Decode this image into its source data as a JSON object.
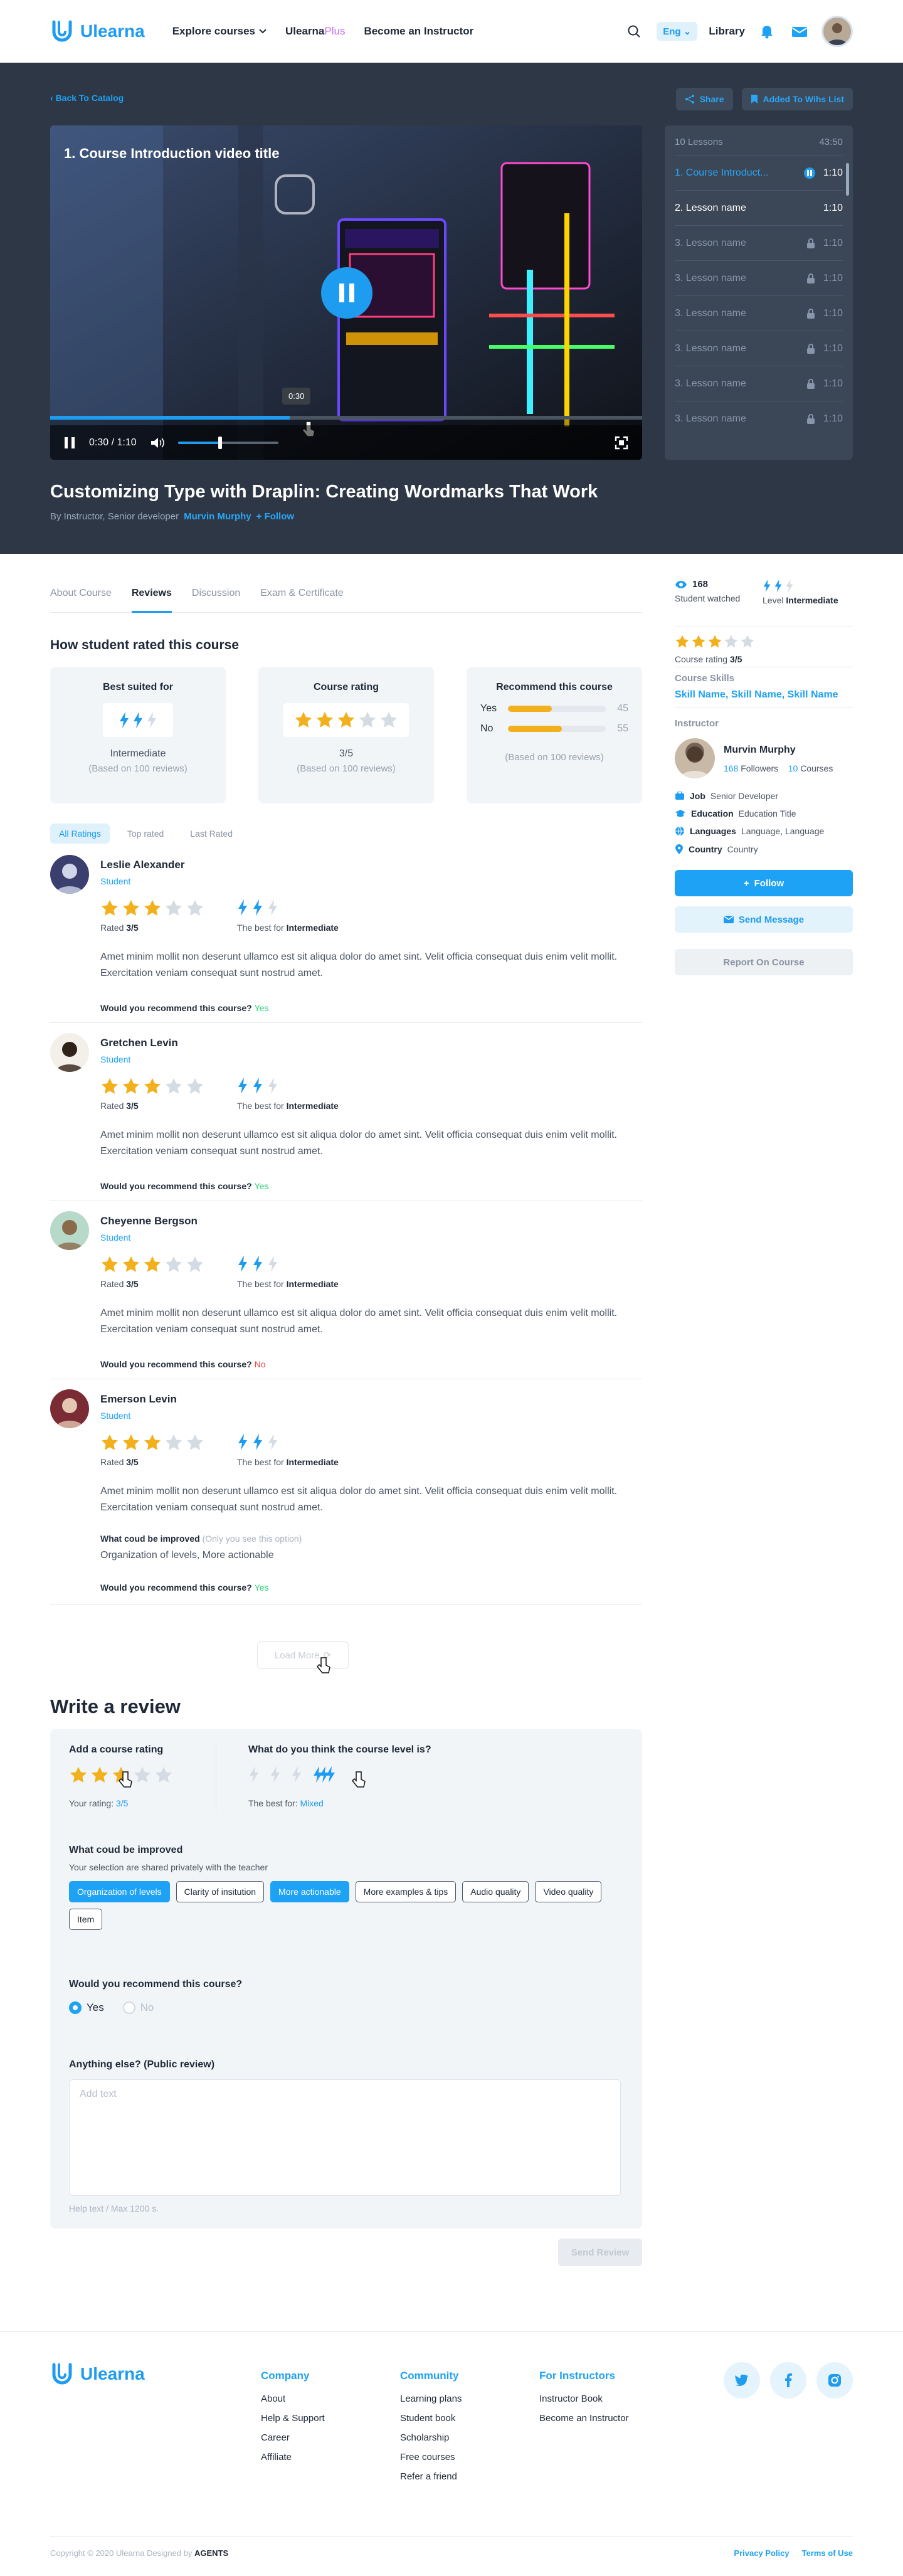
{
  "header": {
    "logo": "Ulearna",
    "nav": {
      "explore": "Explore courses",
      "plus_a": "Ulearna",
      "plus_b": "Plus",
      "instructor": "Become an Instructor"
    },
    "lang": "Eng",
    "library": "Library"
  },
  "hero": {
    "back": "Back To Catalog",
    "share": "Share",
    "wishlist": "Added To Wihs List",
    "video_title": "1. Course Introduction video title",
    "tooltip": "0:30",
    "time": "0:30 / 1:10",
    "progress": 0.405,
    "volume": 0.4,
    "title": "Customizing Type with Draplin: Creating Wordmarks That Work",
    "by": "By Instructor, Senior developer",
    "instructor": "Murvin Murphy",
    "follow": "Follow"
  },
  "lessons": {
    "count": "10 Lessons",
    "total": "43:50",
    "items": [
      {
        "title": "1. Course Introduct...",
        "dur": "1:10"
      },
      {
        "title": "2. Lesson name",
        "dur": "1:10"
      },
      {
        "title": "3. Lesson name",
        "dur": "1:10"
      },
      {
        "title": "3. Lesson name",
        "dur": "1:10"
      },
      {
        "title": "3. Lesson name",
        "dur": "1:10"
      },
      {
        "title": "3. Lesson name",
        "dur": "1:10"
      },
      {
        "title": "3. Lesson name",
        "dur": "1:10"
      },
      {
        "title": "3. Lesson name",
        "dur": "1:10"
      }
    ]
  },
  "tabs": [
    "About Course",
    "Reviews",
    "Discussion",
    "Exam & Certificate"
  ],
  "rated": {
    "heading": "How student rated this course",
    "best": {
      "title": "Best suited for",
      "value": "Intermediate",
      "note": "(Based on 100 reviews)"
    },
    "rating": {
      "title": "Course rating",
      "value": "3/5",
      "note": "(Based on 100 reviews)"
    },
    "recommend": {
      "title": "Recommend this course",
      "yes": "Yes",
      "yes_n": "45",
      "no": "No",
      "no_n": "55",
      "note": "(Based on 100 reviews)"
    }
  },
  "filters": [
    "All Ratings",
    "Top rated",
    "Last Rated"
  ],
  "review_labels": {
    "rated": "Rated",
    "best": "The best for",
    "question": "Would you recommend this course?",
    "improve": "What coud be improved",
    "improve_note": "(Only you see this option)"
  },
  "reviews": [
    {
      "name": "Leslie Alexander",
      "role": "Student",
      "score": "3/5",
      "level": "Intermediate",
      "text": "Amet minim mollit non deserunt ullamco est sit aliqua dolor do amet sint. Velit officia consequat duis enim velit mollit. Exercitation veniam consequat sunt nostrud amet.",
      "answer": "Yes"
    },
    {
      "name": "Gretchen Levin",
      "role": "Student",
      "score": "3/5",
      "level": "Intermediate",
      "text": "Amet minim mollit non deserunt ullamco est sit aliqua dolor do amet sint. Velit officia consequat duis enim velit mollit. Exercitation veniam consequat sunt nostrud amet.",
      "answer": "Yes"
    },
    {
      "name": "Cheyenne Bergson",
      "role": "Student",
      "score": "3/5",
      "level": "Intermediate",
      "text": "Amet minim mollit non deserunt ullamco est sit aliqua dolor do amet sint. Velit officia consequat duis enim velit mollit. Exercitation veniam consequat sunt nostrud amet.",
      "answer": "No"
    },
    {
      "name": "Emerson Levin",
      "role": "Student",
      "score": "3/5",
      "level": "Intermediate",
      "text": "Amet minim mollit non deserunt ullamco est sit aliqua dolor do amet sint. Velit officia consequat duis enim velit mollit. Exercitation veniam consequat sunt nostrud amet.",
      "improve": "Organization of levels, More actionable",
      "answer": "Yes"
    }
  ],
  "load_more": "Load More",
  "write": {
    "heading": "Write a review",
    "add_rating": "Add a course rating",
    "your_rating": "Your rating:",
    "your_rating_v": "3/5",
    "level_q": "What do you think the course level is?",
    "best_for": "The best for:",
    "best_for_v": "Mixed",
    "improve_h": "What coud be improved",
    "improve_sub": "Your selection are shared privately with the teacher",
    "chips": [
      "Organization of levels",
      "Clarity of insitution",
      "More actionable",
      "More examples & tips",
      "Audio quality",
      "Video quality",
      "Item"
    ],
    "recommend_q": "Would you recommend this course?",
    "yes": "Yes",
    "no": "No",
    "anything": "Anything else? (Public review)",
    "placeholder": "Add text",
    "help": "Help text / Max 1200 s.",
    "send": "Send Review"
  },
  "sidebar": {
    "watched_n": "168",
    "watched_l": "Student watched",
    "level_l": "Level",
    "level_v": "Intermediate",
    "course_rating": "Course rating",
    "course_rating_v": "3/5",
    "skills_h": "Course Skills",
    "skills": "Skill Name, Skill Name, Skill Name",
    "instructor_h": "Instructor",
    "inst_name": "Murvin Murphy",
    "followers_n": "168",
    "followers_l": "Followers",
    "courses_n": "10",
    "courses_l": "Courses",
    "job_l": "Job",
    "job_v": "Senior Developer",
    "edu_l": "Education",
    "edu_v": "Education Title",
    "lang_l": "Languages",
    "lang_v": "Language, Language",
    "country_l": "Country",
    "country_v": "Country",
    "follow": "Follow",
    "message": "Send Message",
    "report": "Report On Course"
  },
  "footer": {
    "logo": "Ulearna",
    "company": {
      "h": "Company",
      "items": [
        "About",
        "Help & Support",
        "Career",
        "Affiliate"
      ]
    },
    "community": {
      "h": "Community",
      "items": [
        "Learning plans",
        "Student book",
        "Scholarship",
        "Free courses",
        "Refer a friend"
      ]
    },
    "instructors": {
      "h": "For Instructors",
      "items": [
        "Instructor Book",
        "Become an Instructor"
      ]
    },
    "copyright": "Copyright © 2020 Ulearna Designed by",
    "agency": "AGENTS",
    "privacy": "Privacy Policy",
    "terms": "Terms of Use"
  },
  "colors": {
    "accent": "#1E9CF0",
    "star": "#F2B11C",
    "hero_bg": "#2D3745",
    "plus": "#C46CF0"
  }
}
